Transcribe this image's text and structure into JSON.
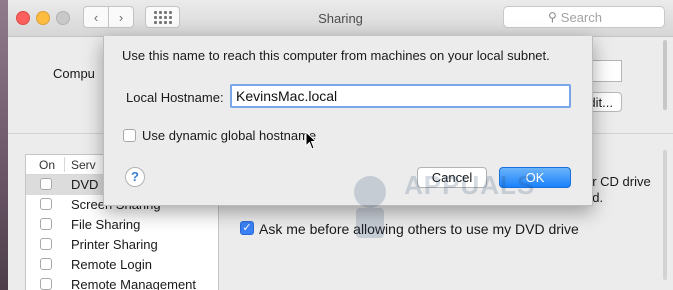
{
  "window": {
    "title": "Sharing",
    "search_placeholder": "Search"
  },
  "background": {
    "computer_name_label": "Compu",
    "edit_button": "dit...",
    "list_header_on": "On",
    "list_header_service": "Serv",
    "services": [
      {
        "label": "DVD",
        "checked": false,
        "selected": true
      },
      {
        "label": "Screen Sharing",
        "checked": false,
        "selected": false
      },
      {
        "label": "File Sharing",
        "checked": false,
        "selected": false
      },
      {
        "label": "Printer Sharing",
        "checked": false,
        "selected": false
      },
      {
        "label": "Remote Login",
        "checked": false,
        "selected": false
      },
      {
        "label": "Remote Management",
        "checked": false,
        "selected": false
      }
    ],
    "dvd_info_line1": "or CD drive",
    "dvd_info_line2": "ed.",
    "ask_permission_label": "Ask me before allowing others to use my DVD drive",
    "ask_permission_checked": true
  },
  "sheet": {
    "description": "Use this name to reach this computer from machines on your local subnet.",
    "hostname_label": "Local Hostname:",
    "hostname_value": "KevinsMac.local",
    "dynamic_hostname_label": "Use dynamic global hostname",
    "dynamic_hostname_checked": false,
    "help_label": "?",
    "cancel_label": "Cancel",
    "ok_label": "OK"
  },
  "colors": {
    "accent": "#1a82fb",
    "close": "#fc605c",
    "minimize": "#fdbc40"
  }
}
